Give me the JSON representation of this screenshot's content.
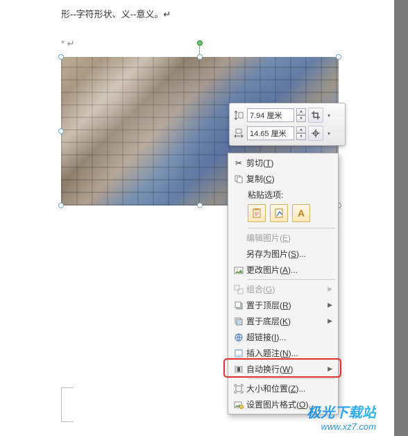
{
  "document": {
    "top_text": "形--字符形状、义--意义。↵",
    "return_mark": "* ↵"
  },
  "size_toolbar": {
    "height_value": "7.94 厘米",
    "width_value": "14.65 厘米"
  },
  "context_menu": {
    "cut": "剪切(T)",
    "copy": "复制(C)",
    "paste_header": "粘贴选项:",
    "edit_picture": "编辑图片(E)",
    "save_as_picture": "另存为图片(S)...",
    "change_picture": "更改图片(A)...",
    "group": "组合(G)",
    "bring_front": "置于顶层(R)",
    "send_back": "置于底层(K)",
    "hyperlink": "超链接(I)...",
    "insert_caption": "插入题注(N)...",
    "text_wrap": "自动换行(W)",
    "size_position": "大小和位置(Z)...",
    "format_picture": "设置图片格式(O)..."
  },
  "watermark": {
    "name": "极光下载站",
    "url": "www.xz7.com"
  }
}
